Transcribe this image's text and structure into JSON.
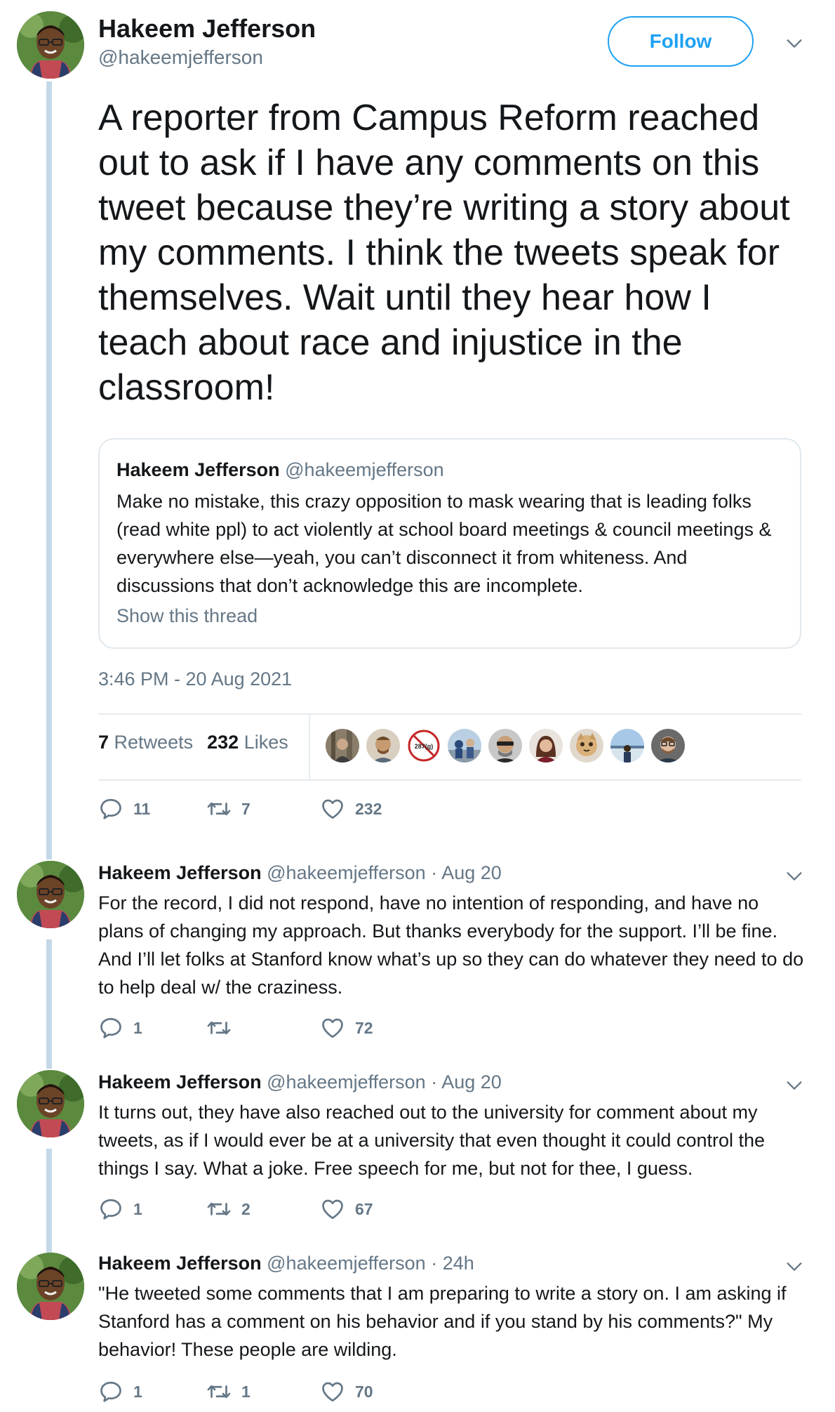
{
  "main_tweet": {
    "name": "Hakeem Jefferson",
    "handle": "@hakeemjefferson",
    "follow_label": "Follow",
    "text": "A reporter from Campus Reform reached out to ask if I have any comments on this tweet because they’re writing a story about my comments. I think the tweets speak for themselves. Wait until they hear how I teach about race and injustice in the classroom!",
    "quoted": {
      "name": "Hakeem Jefferson",
      "handle": "@hakeemjefferson",
      "text": "Make no mistake, this crazy opposition to mask wearing that is leading folks (read white ppl) to act violently at school board meetings & council meetings & everywhere else—yeah, you can’t disconnect it from whiteness. And discussions that don’t acknowledge this are incomplete.",
      "show_thread": "Show this thread"
    },
    "timestamp": "3:46 PM - 20 Aug 2021",
    "retweets_count": "7",
    "retweets_label": "Retweets",
    "likes_count": "232",
    "likes_label": "Likes",
    "liker_badge_text": "287(g)",
    "actions": {
      "replies": "11",
      "retweets": "7",
      "likes": "232"
    }
  },
  "replies": [
    {
      "name": "Hakeem Jefferson",
      "handle": "@hakeemjefferson",
      "time": "· Aug 20",
      "text": "For the record, I did not respond, have no intention of responding, and have no plans of changing my approach. But thanks everybody for the support. I’ll be fine. And I’ll let folks at Stanford know what’s up so they can do whatever they need to do to help deal w/ the craziness.",
      "replies": "1",
      "retweets": "",
      "likes": "72"
    },
    {
      "name": "Hakeem Jefferson",
      "handle": "@hakeemjefferson",
      "time": "· Aug 20",
      "text": "It turns out, they have also reached out to the university for comment about my tweets, as if I would ever be at a university that even thought it could control the things I say. What a joke. Free speech for me, but not for thee, I guess.",
      "replies": "1",
      "retweets": "2",
      "likes": "67"
    },
    {
      "name": "Hakeem Jefferson",
      "handle": "@hakeemjefferson",
      "time": "· 24h",
      "text": "\"He tweeted some comments that I am preparing to write a story on. I am asking if Stanford has a comment on his behavior and if you stand by his comments?\" My behavior! These people are wilding.",
      "replies": "1",
      "retweets": "1",
      "likes": "70"
    }
  ],
  "colors": {
    "accent": "#1da1f2",
    "thread_line": "#c4d9e8",
    "secondary_text": "#657786",
    "primary_text": "#14171a"
  },
  "icons": [
    "reply-icon",
    "retweet-icon",
    "like-icon",
    "chevron-down-icon"
  ]
}
